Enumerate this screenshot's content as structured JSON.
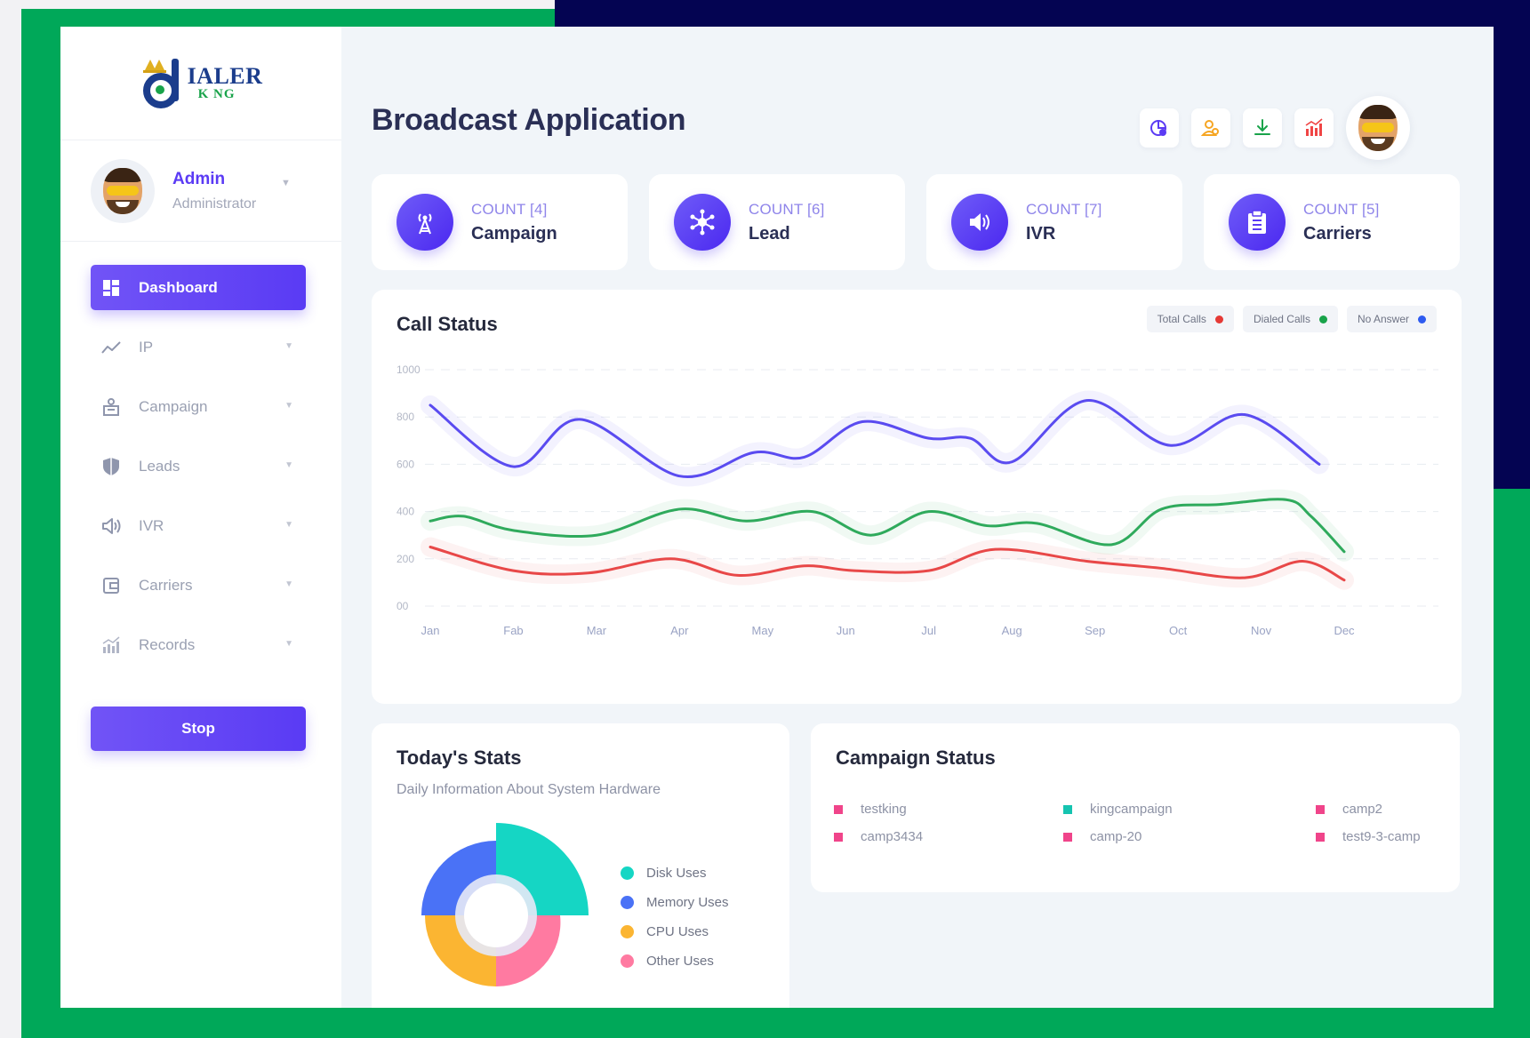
{
  "brand": {
    "logo_word1": "IALER",
    "logo_word2": "K NG"
  },
  "profile": {
    "name": "Admin",
    "role": "Administrator"
  },
  "sidebar": {
    "items": [
      {
        "label": "Dashboard",
        "icon": "dashboard-icon",
        "active": true
      },
      {
        "label": "IP",
        "icon": "trend-icon"
      },
      {
        "label": "Campaign",
        "icon": "campaign-icon"
      },
      {
        "label": "Leads",
        "icon": "shield-icon"
      },
      {
        "label": "IVR",
        "icon": "speaker-icon"
      },
      {
        "label": "Carriers",
        "icon": "wallet-icon"
      },
      {
        "label": "Records",
        "icon": "bar-chart-icon"
      }
    ],
    "stop_label": "Stop"
  },
  "header": {
    "title": "Broadcast Application",
    "actions": [
      "pie-chart-icon",
      "users-icon",
      "download-icon",
      "chart-icon"
    ]
  },
  "cards": [
    {
      "count": "COUNT [4]",
      "label": "Campaign",
      "icon": "tower-icon"
    },
    {
      "count": "COUNT [6]",
      "label": "Lead",
      "icon": "network-icon"
    },
    {
      "count": "COUNT [7]",
      "label": "IVR",
      "icon": "speaker-icon"
    },
    {
      "count": "COUNT [5]",
      "label": "Carriers",
      "icon": "clipboard-icon"
    }
  ],
  "call_status": {
    "title": "Call Status",
    "legend": [
      "Total Calls",
      "Dialed Calls",
      "No Answer"
    ]
  },
  "colors": {
    "accent": "#5b3bf4",
    "total_calls": "#e53935",
    "dialed_calls": "#19a34a",
    "no_answer": "#2e5bf0",
    "line_no_answer": "#5a4bf0",
    "line_dialed": "#2faa5c",
    "line_total": "#e84848"
  },
  "chart_data": {
    "type": "line",
    "title": "Call Status",
    "categories": [
      "Jan",
      "Fab",
      "Mar",
      "Apr",
      "May",
      "Jun",
      "Jul",
      "Aug",
      "Sep",
      "Oct",
      "Nov",
      "Dec"
    ],
    "y_ticks": [
      "1000",
      "800",
      "600",
      "400",
      "200",
      "00"
    ],
    "ylim": [
      0,
      1000
    ],
    "grid": true,
    "legend_position": "top-right",
    "series": [
      {
        "name": "No Answer",
        "color": "#5a4bf0",
        "x": [
          0,
          1,
          1.8,
          3,
          3.9,
          4.5,
          5.2,
          6.0,
          6.5,
          7.0,
          7.9,
          8.9,
          9.8,
          10.7
        ],
        "values": [
          850,
          590,
          790,
          550,
          650,
          630,
          780,
          710,
          710,
          610,
          870,
          680,
          810,
          600
        ]
      },
      {
        "name": "Dialed Calls",
        "color": "#2faa5c",
        "x": [
          0,
          0.4,
          1,
          2,
          3,
          3.8,
          4.6,
          5.3,
          6.0,
          6.7,
          7.3,
          8.2,
          8.8,
          9.5,
          10.3,
          10.6,
          11
        ],
        "values": [
          360,
          380,
          320,
          300,
          410,
          360,
          400,
          300,
          400,
          340,
          350,
          260,
          410,
          430,
          450,
          380,
          230
        ]
      },
      {
        "name": "Total Calls",
        "color": "#e84848",
        "x": [
          0,
          1,
          1.9,
          2.9,
          3.7,
          4.5,
          5.1,
          6.0,
          6.8,
          7.9,
          8.8,
          9.8,
          10.5,
          11
        ],
        "values": [
          250,
          150,
          140,
          200,
          130,
          170,
          150,
          150,
          240,
          190,
          160,
          120,
          190,
          110
        ]
      }
    ]
  },
  "todays_stats": {
    "title": "Today's Stats",
    "subtitle": "Daily Information About System Hardware",
    "legend": [
      {
        "label": "Disk Uses",
        "color": "#15d6c4"
      },
      {
        "label": "Memory Uses",
        "color": "#4a72f6"
      },
      {
        "label": "CPU Uses",
        "color": "#fbb532"
      },
      {
        "label": "Other Uses",
        "color": "#ff7aa1"
      }
    ]
  },
  "campaign_status": {
    "title": "Campaign Status",
    "items": [
      {
        "label": "testking",
        "color": "#f0448a"
      },
      {
        "label": "kingcampaign",
        "color": "#15c4b0"
      },
      {
        "label": "camp2",
        "color": "#f0448a"
      },
      {
        "label": "camp3434",
        "color": "#f0448a"
      },
      {
        "label": "camp-20",
        "color": "#f0448a"
      },
      {
        "label": "test9-3-camp",
        "color": "#f0448a"
      }
    ]
  }
}
